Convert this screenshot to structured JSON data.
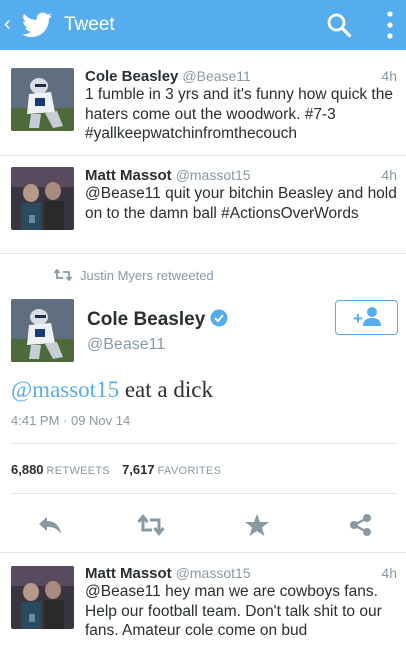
{
  "topbar": {
    "title": "Tweet",
    "icons": [
      "back-chevron-icon",
      "twitter-bird-icon",
      "search-icon",
      "more-vertical-icon"
    ],
    "color": "#55acee"
  },
  "tweets_above": [
    {
      "name": "Cole Beasley",
      "handle": "@Bease11",
      "time": "4h",
      "text": "1 fumble in 3 yrs and it's funny how quick the haters come out the woodwork. #7-3 #yallkeepwatchinfromthecouch"
    },
    {
      "name": "Matt Massot",
      "handle": "@massot15",
      "time": "4h",
      "text": "@Bease11 quit your bitchin Beasley and hold on to the damn ball #ActionsOverWords"
    }
  ],
  "focused": {
    "retweeted_by": "Justin Myers retweeted",
    "name": "Cole Beasley",
    "handle": "@Bease11",
    "verified": true,
    "mention": "@massot15",
    "text": " eat a dick",
    "timestamp": "4:41 PM · 09 Nov 14",
    "retweets": "6,880",
    "retweets_label": "RETWEETS",
    "favorites": "7,617",
    "favorites_label": "FAVORITES"
  },
  "actions": [
    "reply-icon",
    "retweet-icon",
    "favorite-star-icon",
    "share-icon"
  ],
  "reply": {
    "name": "Matt Massot",
    "handle": "@massot15",
    "time": "4h",
    "text": "@Bease11 hey man we are cowboys fans. Help our football team. Don't talk shit to our fans. Amateur cole come on bud"
  },
  "colors": {
    "accent": "#55acee",
    "muted": "#8899a6",
    "text": "#292f33",
    "divider": "#e1e8ed"
  }
}
